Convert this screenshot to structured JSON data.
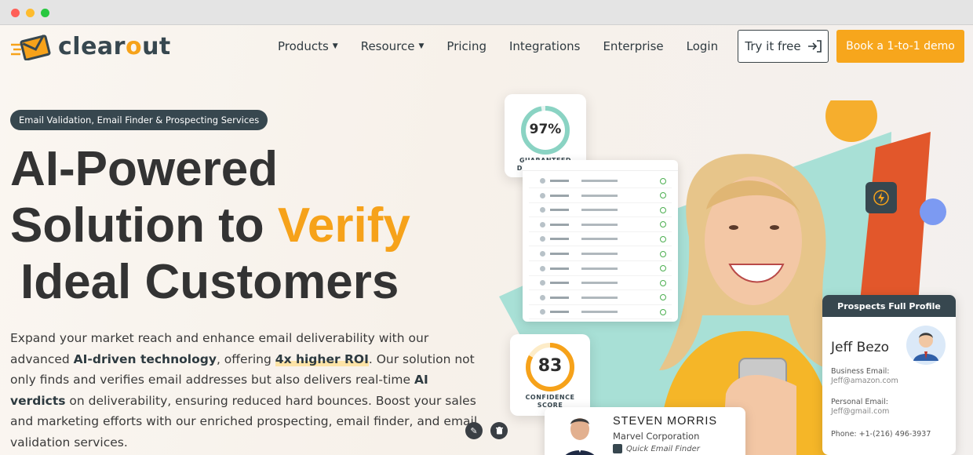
{
  "brand": {
    "name_start": "clear",
    "name_o": "o",
    "name_end": "ut",
    "accent_color": "#f6a21a",
    "dark_color": "#37474f"
  },
  "nav": {
    "products": "Products",
    "resource": "Resource",
    "pricing": "Pricing",
    "integrations": "Integrations",
    "enterprise": "Enterprise",
    "login": "Login",
    "try_free": "Try it free",
    "book_demo": "Book a 1-to-1 demo"
  },
  "hero": {
    "badge": "Email Validation, Email Finder & Prospecting Services",
    "line1": "AI-Powered",
    "line2_start": "Solution to ",
    "line2_accent": "Verify",
    "line3": "Ideal Customers",
    "desc_1": "Expand your market reach and enhance email deliverability with our advanced ",
    "desc_b1": "AI-driven technology",
    "desc_2": ", offering ",
    "desc_hl": "4x higher ROI",
    "desc_3": ". Our solution not only finds and verifies email addresses but also delivers real-time ",
    "desc_b2": "AI verdicts",
    "desc_4": " on deliverability, ensuring reduced hard bounces. Boost your sales and marketing efforts with our enriched prospecting, email finder, and email validation services."
  },
  "deliverables_card": {
    "value": "97%",
    "percent": 97,
    "label_1": "GUARANTEED",
    "label_2": "DELIVERABLES"
  },
  "confidence_card": {
    "value": "83",
    "percent": 83,
    "label_1": "CONFIDENCE",
    "label_2": "SCORE"
  },
  "profile_card": {
    "title": "Prospects Full Profile",
    "name": "Jeff Bezo",
    "business_label": "Business Email:",
    "business_value": "Jeff@amazon.com",
    "personal_label": "Personal Email:",
    "personal_value": "Jeff@gmail.com",
    "phone_label": "Phone: +1-(216) 496-3937"
  },
  "morris_card": {
    "name": "STEVEN MORRIS",
    "company": "Marvel Corporation",
    "tag": "Quick Email Finder"
  },
  "table_rows": 10
}
